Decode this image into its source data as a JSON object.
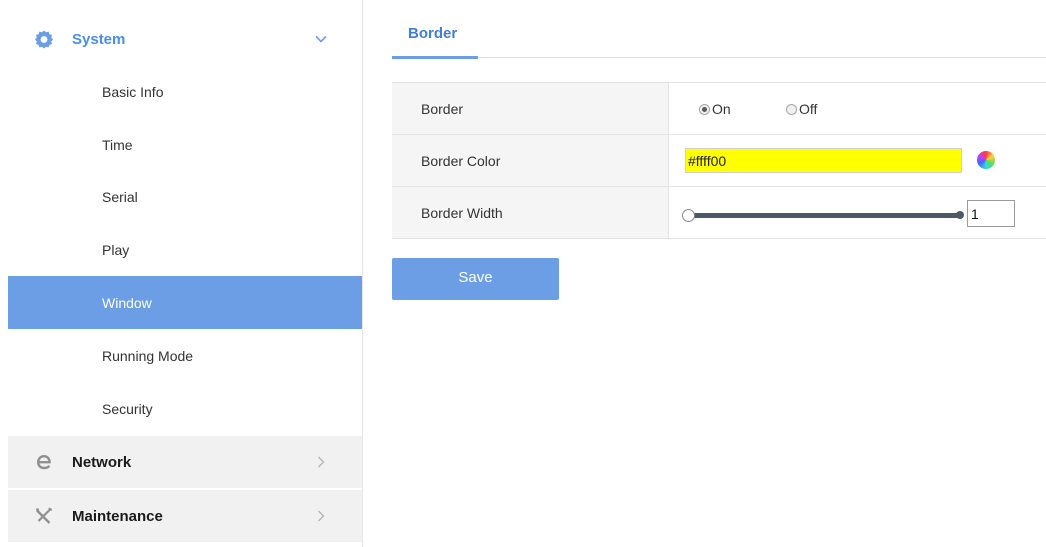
{
  "sidebar": {
    "system": {
      "label": "System",
      "icon": "gear-icon",
      "chevron": "chevron-down-icon"
    },
    "items": [
      {
        "label": "Basic Info",
        "active": false
      },
      {
        "label": "Time",
        "active": false
      },
      {
        "label": "Serial",
        "active": false
      },
      {
        "label": "Play",
        "active": false
      },
      {
        "label": "Window",
        "active": true
      },
      {
        "label": "Running Mode",
        "active": false
      },
      {
        "label": "Security",
        "active": false
      }
    ],
    "network": {
      "label": "Network",
      "icon": "network-e-icon",
      "chevron": "chevron-right-icon"
    },
    "maintenance": {
      "label": "Maintenance",
      "icon": "tools-icon",
      "chevron": "chevron-right-icon"
    }
  },
  "main": {
    "tab": {
      "label": "Border"
    },
    "form": {
      "border": {
        "label": "Border",
        "options": [
          "On",
          "Off"
        ],
        "selected": "On"
      },
      "border_color": {
        "label": "Border Color",
        "value": "#ffff00"
      },
      "border_width": {
        "label": "Border Width",
        "value": "1"
      }
    },
    "save_label": "Save"
  },
  "colors": {
    "accent": "#6c9ee6",
    "system_label": "#4a8fe7",
    "tab_label": "#3f7fd6",
    "section_bg": "#f1f1f1",
    "color_swatch": "#ffff00",
    "slider_track": "#4c5966"
  }
}
